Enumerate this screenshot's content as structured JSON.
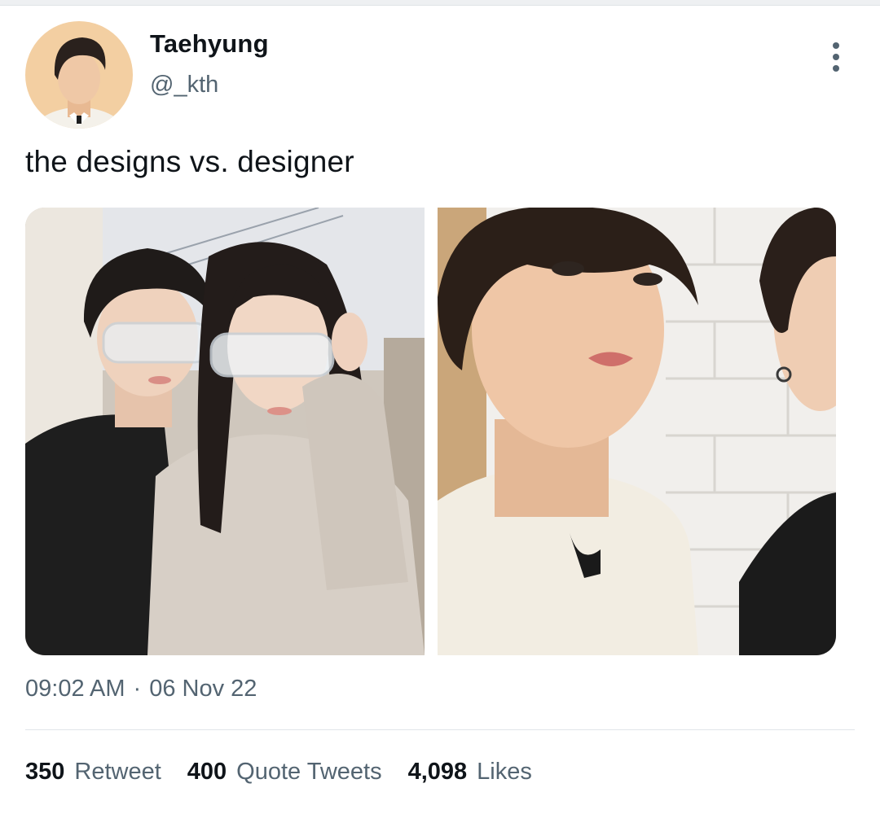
{
  "author": {
    "display_name": "Taehyung",
    "handle": "@_kth",
    "avatar_icon": "profile-photo"
  },
  "more_icon": "vertical-ellipsis-icon",
  "tweet": {
    "text": "the designs vs. designer",
    "time": "09:02 AM",
    "separator": "·",
    "date": "06 Nov 22"
  },
  "media": [
    {
      "kind": "photo"
    },
    {
      "kind": "photo"
    }
  ],
  "stats": {
    "retweets": {
      "count": "350",
      "label": "Retweet"
    },
    "quotes": {
      "count": "400",
      "label": "Quote Tweets"
    },
    "likes": {
      "count": "4,098",
      "label": "Likes"
    }
  },
  "colors": {
    "primary_text": "#0f1419",
    "secondary_text": "#536471",
    "divider": "#e1e6ea"
  }
}
